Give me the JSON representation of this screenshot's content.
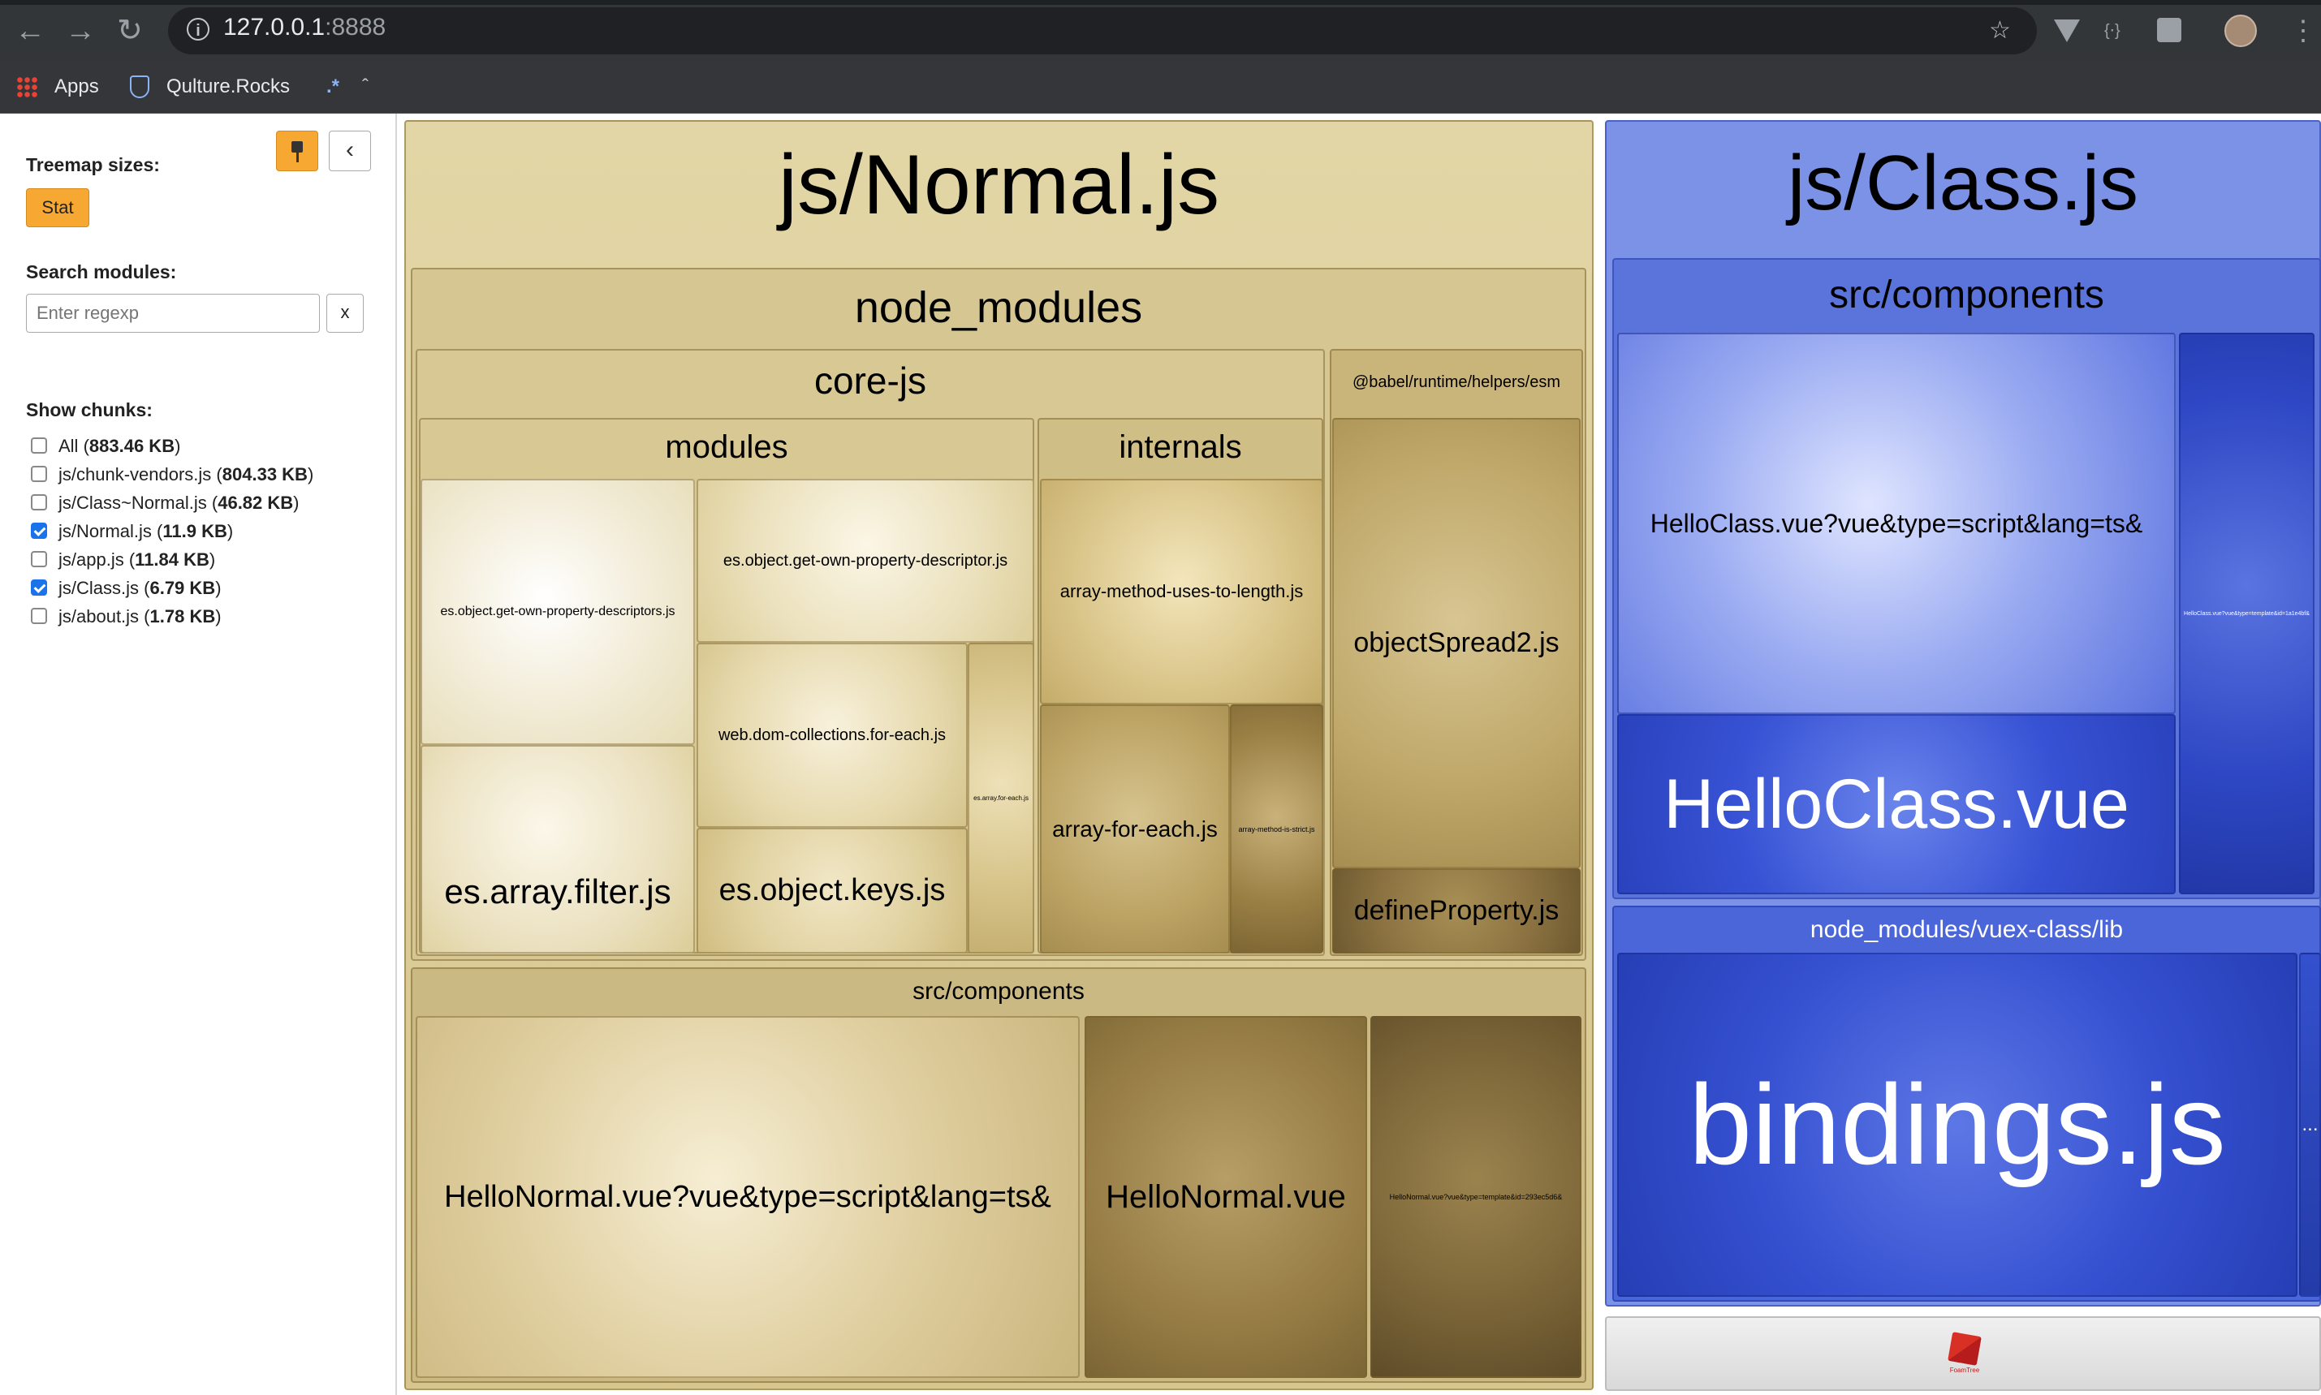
{
  "browser": {
    "url_host": "127.0.0.1",
    "url_port": ":8888",
    "bookmarks": [
      "Apps",
      "Qulture.Rocks",
      ".*"
    ],
    "icons": [
      "back-arrow-icon",
      "forward-arrow-icon",
      "reload-icon",
      "info-icon",
      "star-icon",
      "vue-devtools-icon",
      "extension-icon",
      "lighthouse-icon",
      "avatar",
      "menu-dots-icon"
    ]
  },
  "sidebar": {
    "treemap_sizes_label": "Treemap sizes:",
    "stat_label": "Stat",
    "search_label": "Search modules:",
    "search_placeholder": "Enter regexp",
    "search_clear": "x",
    "show_chunks_label": "Show chunks:",
    "chunks": [
      {
        "name": "All",
        "size": "883.46 KB",
        "checked": false
      },
      {
        "name": "js/chunk-vendors.js",
        "size": "804.33 KB",
        "checked": false
      },
      {
        "name": "js/Class~Normal.js",
        "size": "46.82 KB",
        "checked": false
      },
      {
        "name": "js/Normal.js",
        "size": "11.9 KB",
        "checked": true
      },
      {
        "name": "js/app.js",
        "size": "11.84 KB",
        "checked": false
      },
      {
        "name": "js/Class.js",
        "size": "6.79 KB",
        "checked": true
      },
      {
        "name": "js/about.js",
        "size": "1.78 KB",
        "checked": false
      }
    ]
  },
  "treemap": {
    "normal": {
      "title": "js/Normal.js",
      "node_modules": "node_modules",
      "core_js": "core-js",
      "modules": "modules",
      "internals": "internals",
      "babel": "@babel/runtime/helpers/esm",
      "src_components": "src/components",
      "files": {
        "desc_s": "es.object.get-own-property-descriptors.js",
        "desc": "es.object.get-own-property-descriptor.js",
        "filter": "es.array.filter.js",
        "dom_for_each": "web.dom-collections.for-each.js",
        "keys": "es.object.keys.js",
        "arr_for_each_small": "es.array.for-each.js",
        "uses_to_length": "array-method-uses-to-length.js",
        "arr_for_each": "array-for-each.js",
        "is_strict": "array-method-is-strict.js",
        "spread": "objectSpread2.js",
        "define_prop": "defineProperty.js",
        "hello_script": "HelloNormal.vue?vue&type=script&lang=ts&",
        "hello_vue": "HelloNormal.vue",
        "hello_template": "HelloNormal.vue?vue&type=template&id=293ec5d6&"
      }
    },
    "class": {
      "title": "js/Class.js",
      "src_components": "src/components",
      "hello_script": "HelloClass.vue?vue&type=script&lang=ts&",
      "hello_vue": "HelloClass.vue",
      "hello_template": "HelloClass.vue?vue&type=template&id=1a1e4bf&",
      "vuex_lib": "node_modules/vuex-class/lib",
      "bindings": "bindings.js",
      "more": "..."
    },
    "footer_logo": "FoamTree"
  }
}
